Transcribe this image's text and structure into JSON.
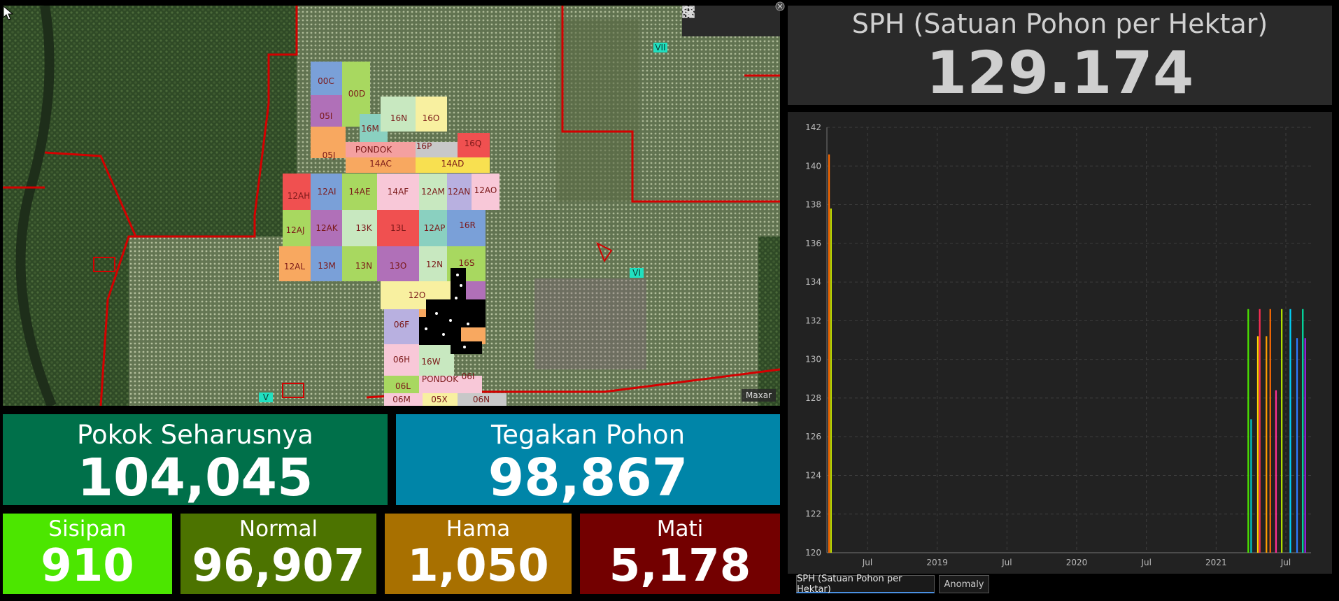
{
  "map": {
    "attribution": "Maxar",
    "blocks": [
      "00C",
      "00D",
      "05I",
      "16M",
      "16N",
      "16O",
      "05J",
      "PONDOK",
      "16P",
      "16Q",
      "14AC",
      "14AD",
      "12AH",
      "12AI",
      "14AE",
      "14AF",
      "12AM",
      "12AN",
      "12AO",
      "12AJ",
      "12AK",
      "13K",
      "13L",
      "12AP",
      "16R",
      "12AL",
      "13M",
      "13N",
      "13O",
      "12N",
      "16S",
      "12O",
      "06F",
      "16W",
      "06H",
      "PONDOK",
      "06I",
      "06L",
      "06M",
      "05X",
      "06N"
    ],
    "regions": [
      "VII",
      "VI",
      "V"
    ],
    "tools": [
      "search-icon",
      "legend-icon",
      "layers-icon",
      "basemap-gallery-icon"
    ]
  },
  "kpi": {
    "pokok": {
      "title": "Pokok Seharusnya",
      "value": "104,045",
      "color": "#00704a"
    },
    "tegakan": {
      "title": "Tegakan Pohon",
      "value": "98,867",
      "color": "#0085a8"
    },
    "sisipan": {
      "title": "Sisipan",
      "value": "910",
      "color": "#4ce600"
    },
    "normal": {
      "title": "Normal",
      "value": "96,907",
      "color": "#4c7300"
    },
    "hama": {
      "title": "Hama",
      "value": "1,050",
      "color": "#a87000"
    },
    "mati": {
      "title": "Mati",
      "value": "5,178",
      "color": "#730000"
    }
  },
  "sph": {
    "title": "SPH (Satuan Pohon per Hektar)",
    "value": "129.174"
  },
  "chart_data": {
    "type": "bar",
    "y_ticks": [
      120,
      122,
      124,
      126,
      128,
      130,
      132,
      134,
      136,
      138,
      140,
      142
    ],
    "ylim": [
      120,
      142
    ],
    "x_ticks": [
      "Jul",
      "2019",
      "Jul",
      "2020",
      "Jul",
      "2021",
      "Jul"
    ],
    "grid": true,
    "bars": [
      {
        "t": 0.0,
        "value": 140.6,
        "color": "#ff6a00"
      },
      {
        "t": 0.004,
        "value": 137.8,
        "color": "#c8e600"
      },
      {
        "t": 0.876,
        "value": 132.6,
        "color": "#4ce600"
      },
      {
        "t": 0.882,
        "value": 126.9,
        "color": "#00c8c8"
      },
      {
        "t": 0.896,
        "value": 131.2,
        "color": "#ffd400"
      },
      {
        "t": 0.9,
        "value": 132.6,
        "color": "#ff2d55"
      },
      {
        "t": 0.914,
        "value": 131.2,
        "color": "#ff9e00"
      },
      {
        "t": 0.922,
        "value": 132.6,
        "color": "#ff6a00"
      },
      {
        "t": 0.934,
        "value": 128.4,
        "color": "#ff2d95"
      },
      {
        "t": 0.946,
        "value": 132.6,
        "color": "#b6e600"
      },
      {
        "t": 0.964,
        "value": 132.6,
        "color": "#00d4ff"
      },
      {
        "t": 0.978,
        "value": 131.1,
        "color": "#2d7cff"
      },
      {
        "t": 0.99,
        "value": 132.6,
        "color": "#00e6a8"
      },
      {
        "t": 0.995,
        "value": 131.1,
        "color": "#a020f0"
      }
    ]
  },
  "tabs": [
    {
      "label": "SPH (Satuan Pohon per Hektar)",
      "active": true
    },
    {
      "label": "Anomaly",
      "active": false
    }
  ]
}
